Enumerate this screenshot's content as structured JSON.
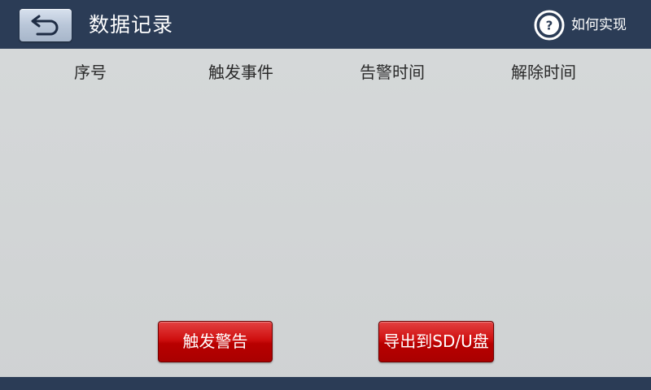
{
  "header": {
    "title": "数据记录",
    "help_label": "如何实现"
  },
  "table": {
    "columns": [
      "序号",
      "触发事件",
      "告警时间",
      "解除时间"
    ],
    "rows": []
  },
  "buttons": {
    "trigger_alarm": "触发警告",
    "export": "导出到SD/U盘"
  },
  "icons": {
    "back": "back-arrow-icon",
    "help": "question-mark-icon"
  },
  "colors": {
    "header_bg": "#2b3c56",
    "button_red": "#cf0f0f",
    "body_bg": "#d3d6d7"
  }
}
